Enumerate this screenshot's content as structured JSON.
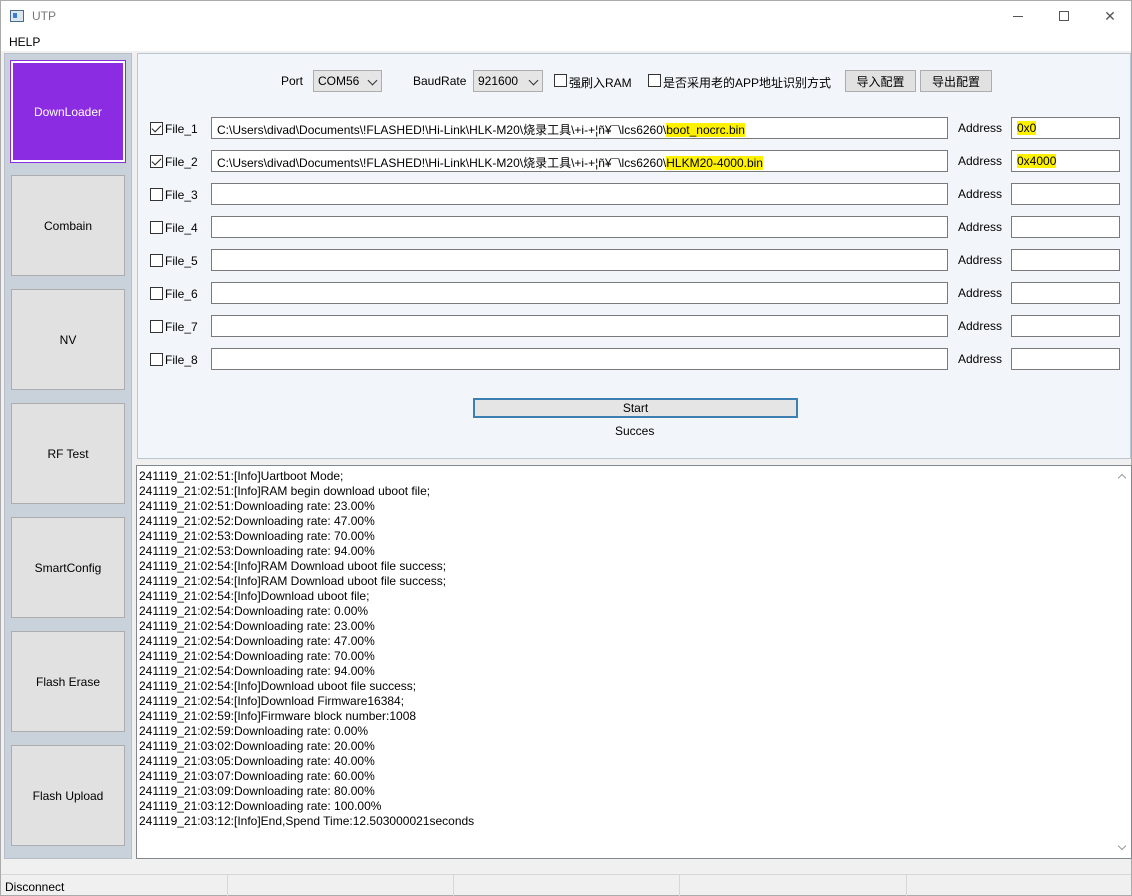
{
  "window": {
    "title": "UTP",
    "menu": [
      "HELP"
    ]
  },
  "sidebar": {
    "items": [
      {
        "label": "DownLoader",
        "active": true
      },
      {
        "label": "Combain",
        "active": false
      },
      {
        "label": "NV",
        "active": false
      },
      {
        "label": "RF Test",
        "active": false
      },
      {
        "label": "SmartConfig",
        "active": false
      },
      {
        "label": "Flash Erase",
        "active": false
      },
      {
        "label": "Flash Upload",
        "active": false
      }
    ]
  },
  "settings": {
    "port_label": "Port",
    "port_value": "COM56",
    "baud_label": "BaudRate",
    "baud_value": "921600",
    "force_ram_label": "强刷入RAM",
    "old_app_label": "是否采用老的APP地址识别方式",
    "import_label": "导入配置",
    "export_label": "导出配置"
  },
  "files": [
    {
      "label": "File_1",
      "checked": true,
      "path_prefix": "C:\\Users\\divad\\Documents\\!FLASHED!\\Hi-Link\\HLK-M20\\烧录工具\\+i-+¦ñ¥¯\\lcs6260\\",
      "path_highlight": "boot_nocrc.bin",
      "address": "0x0"
    },
    {
      "label": "File_2",
      "checked": true,
      "path_prefix": "C:\\Users\\divad\\Documents\\!FLASHED!\\Hi-Link\\HLK-M20\\烧录工具\\+i-+¦ñ¥¯\\lcs6260\\",
      "path_highlight": "HLKM20-4000.bin",
      "address": "0x4000"
    },
    {
      "label": "File_3",
      "checked": false,
      "path_prefix": "",
      "path_highlight": "",
      "address": ""
    },
    {
      "label": "File_4",
      "checked": false,
      "path_prefix": "",
      "path_highlight": "",
      "address": ""
    },
    {
      "label": "File_5",
      "checked": false,
      "path_prefix": "",
      "path_highlight": "",
      "address": ""
    },
    {
      "label": "File_6",
      "checked": false,
      "path_prefix": "",
      "path_highlight": "",
      "address": ""
    },
    {
      "label": "File_7",
      "checked": false,
      "path_prefix": "",
      "path_highlight": "",
      "address": ""
    },
    {
      "label": "File_8",
      "checked": false,
      "path_prefix": "",
      "path_highlight": "",
      "address": ""
    }
  ],
  "address_label": "Address",
  "start_label": "Start",
  "status_text": "Success",
  "log": [
    "241119_21:02:51:[Info]Uartboot Mode;",
    "241119_21:02:51:[Info]RAM begin download uboot file;",
    "241119_21:02:51:Downloading rate: 23.00%",
    "241119_21:02:52:Downloading rate: 47.00%",
    "241119_21:02:53:Downloading rate: 70.00%",
    "241119_21:02:53:Downloading rate: 94.00%",
    "241119_21:02:54:[Info]RAM Download uboot file success;",
    "241119_21:02:54:[Info]RAM Download uboot file success;",
    "241119_21:02:54:[Info]Download uboot file;",
    "241119_21:02:54:Downloading rate: 0.00%",
    "241119_21:02:54:Downloading rate: 23.00%",
    "241119_21:02:54:Downloading rate: 47.00%",
    "241119_21:02:54:Downloading rate: 70.00%",
    "241119_21:02:54:Downloading rate: 94.00%",
    "241119_21:02:54:[Info]Download uboot file success;",
    "241119_21:02:54:[Info]Download Firmware16384;",
    "241119_21:02:59:[Info]Firmware block number:1008",
    "241119_21:02:59:Downloading rate: 0.00%",
    "241119_21:03:02:Downloading rate: 20.00%",
    "241119_21:03:05:Downloading rate: 40.00%",
    "241119_21:03:07:Downloading rate: 60.00%",
    "241119_21:03:09:Downloading rate: 80.00%",
    "241119_21:03:12:Downloading rate: 100.00%",
    "241119_21:03:12:[Info]End,Spend Time:12.503000021seconds"
  ],
  "statusbar": {
    "connection": "Disconnect"
  },
  "colors": {
    "active_nav": "#8b2be2",
    "highlight": "#fff200",
    "start_border": "#3c7fb1"
  }
}
